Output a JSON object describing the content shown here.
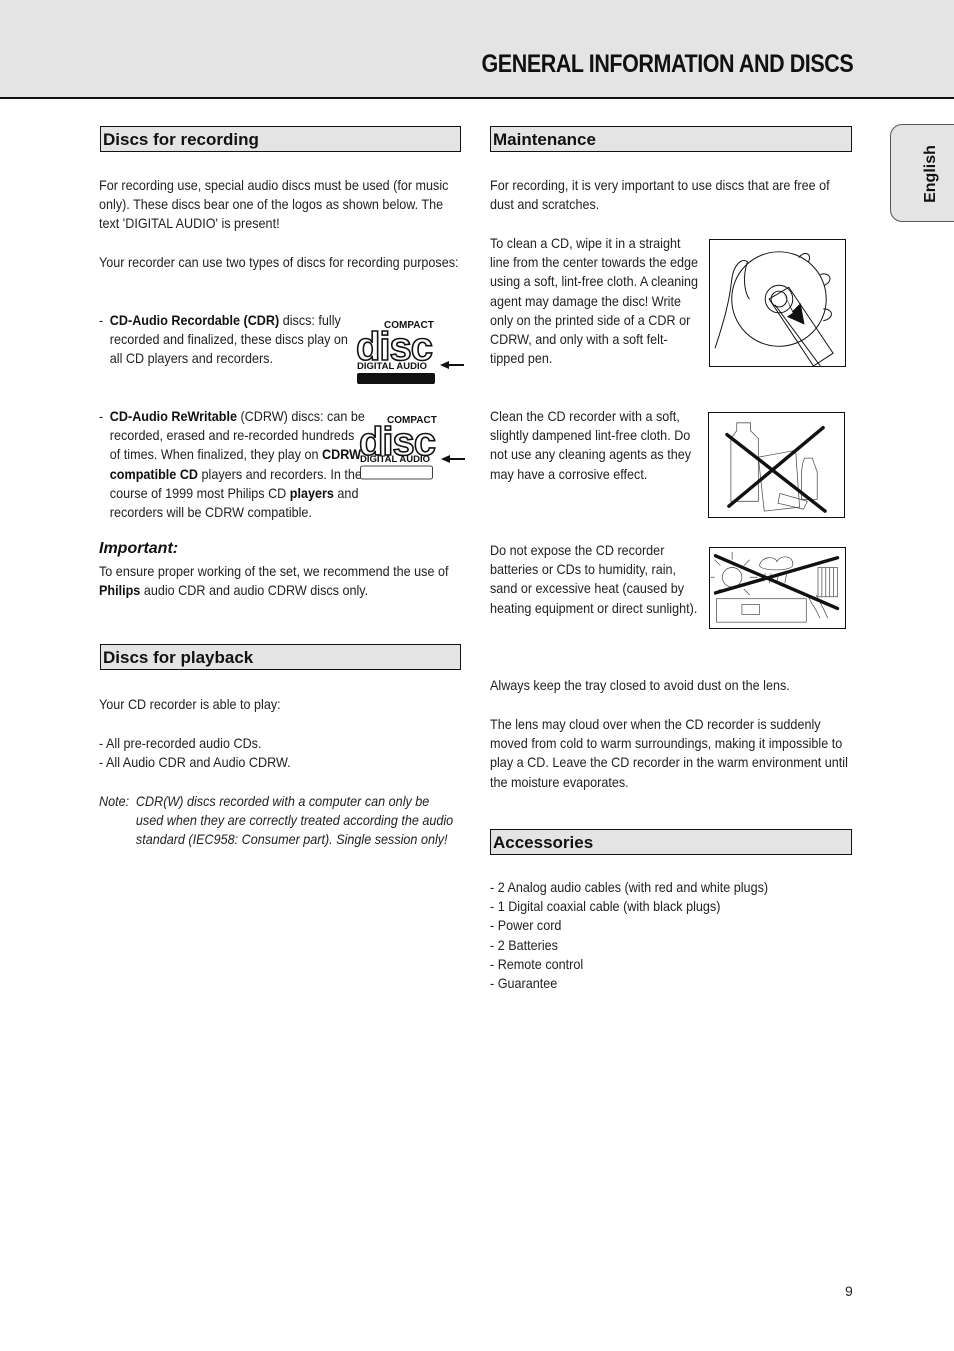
{
  "header": {
    "title": "GENERAL INFORMATION AND DISCS",
    "language_tab": "English"
  },
  "left": {
    "recording": {
      "heading": "Discs for recording",
      "intro_1": "For recording use, special audio discs must be used (for music only). These discs bear one of the logos as shown below. The text 'DIGITAL AUDIO' is present!",
      "intro_2": "Your recorder can use two types of discs for recording purposes:",
      "cdr": {
        "dash": "-",
        "bold": "CD-Audio Recordable (CDR)",
        "rest": " discs: fully recorded and finalized, these discs play on all CD players and recorders."
      },
      "cdrw": {
        "dash": "-",
        "bold": "CD-Audio ReWritable",
        "part1": " (CDRW) discs: can be recorded, erased and re-recorded hundreds of times. When finalized,  they play on ",
        "bold2": "CDRW compatible CD",
        "part2": " players and recorders. In the course of 1999 most Philips CD ",
        "bold3": "players",
        "part3": " and recorders will be CDRW compatible."
      },
      "logo": {
        "top": "COMPACT",
        "middle": "disc",
        "bottom": "DIGITAL AUDIO"
      },
      "important_heading": "Important:",
      "important_text_1": "To ensure proper working of the set, we recommend the use of ",
      "important_bold": "Philips",
      "important_text_2": " audio CDR and audio CDRW discs only."
    },
    "playback": {
      "heading": "Discs for playback",
      "intro": "Your CD recorder is able to play:",
      "items": [
        "- All pre-recorded audio CDs.",
        "- All Audio CDR and Audio CDRW."
      ],
      "note_label": "Note:",
      "note_text": "CDR(W) discs recorded with a computer can only be used when they are correctly treated according the audio standard (IEC958: Consumer part). Single session only!"
    }
  },
  "right": {
    "maintenance": {
      "heading": "Maintenance",
      "p1": "For recording, it is very important to use discs that are free of dust and scratches.",
      "p2": "To clean a CD, wipe it in a straight line from the center towards the edge using a soft, lint-free cloth. A cleaning agent may damage the disc! Write only on the printed side of a CDR or CDRW, and only with a soft felt-tipped pen.",
      "p3": "Clean the CD recorder with a soft, slightly dampened lint-free cloth. Do not use any cleaning agents as they may have a corrosive effect.",
      "p4": "Do not expose the CD recorder batteries or CDs to humidity, rain, sand or excessive heat (caused by heating equipment or direct sunlight).",
      "p5": "Always keep the tray closed to avoid dust on the lens.",
      "p6": "The lens may cloud over when the CD recorder is suddenly moved from cold to warm surroundings, making it impossible to play a CD. Leave the CD recorder in the warm environment until the moisture evaporates."
    },
    "accessories": {
      "heading": "Accessories",
      "items": [
        "- 2 Analog audio cables (with red and white plugs)",
        "- 1 Digital coaxial cable (with black plugs)",
        "- Power cord",
        "- 2 Batteries",
        "- Remote control",
        "- Guarantee"
      ]
    }
  },
  "footer": {
    "page_number": "9"
  }
}
